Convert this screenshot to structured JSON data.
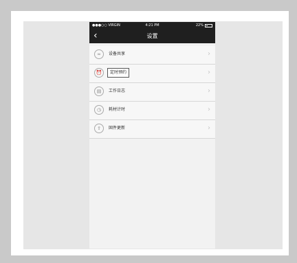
{
  "status_bar": {
    "carrier": "●●●○○ VIRGIN",
    "time": "4:21 PM",
    "battery": "22%"
  },
  "nav": {
    "title": "设置"
  },
  "menu": [
    {
      "label": "设备共享",
      "icon": "link-icon"
    },
    {
      "label": "定时预约",
      "icon": "alarm-clock-icon"
    },
    {
      "label": "工作日志",
      "icon": "log-document-icon"
    },
    {
      "label": "耗材计时",
      "icon": "clock-icon"
    },
    {
      "label": "固件更新",
      "icon": "upload-icon"
    }
  ]
}
